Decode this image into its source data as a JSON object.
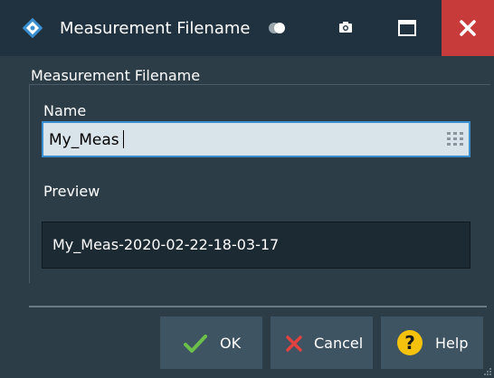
{
  "window": {
    "title": "Measurement Filename"
  },
  "titlebar": {
    "icons": [
      "app-logo-icon",
      "toggle-icon",
      "camera-icon",
      "maximize-icon",
      "close-icon"
    ],
    "close_color": "#c73b3b"
  },
  "group": {
    "title": "Measurement Filename",
    "name_label": "Name",
    "name_value": "My_Meas",
    "preview_label": "Preview",
    "preview_value": "My_Meas-2020-02-22-18-03-17"
  },
  "buttons": {
    "ok": "OK",
    "cancel": "Cancel",
    "help": "Help"
  },
  "colors": {
    "background": "#2c3d48",
    "input_focus_border": "#3a8fd0",
    "ok_check": "#6cc04a",
    "cancel_x": "#e0423f",
    "help_icon": "#f4c20d"
  }
}
